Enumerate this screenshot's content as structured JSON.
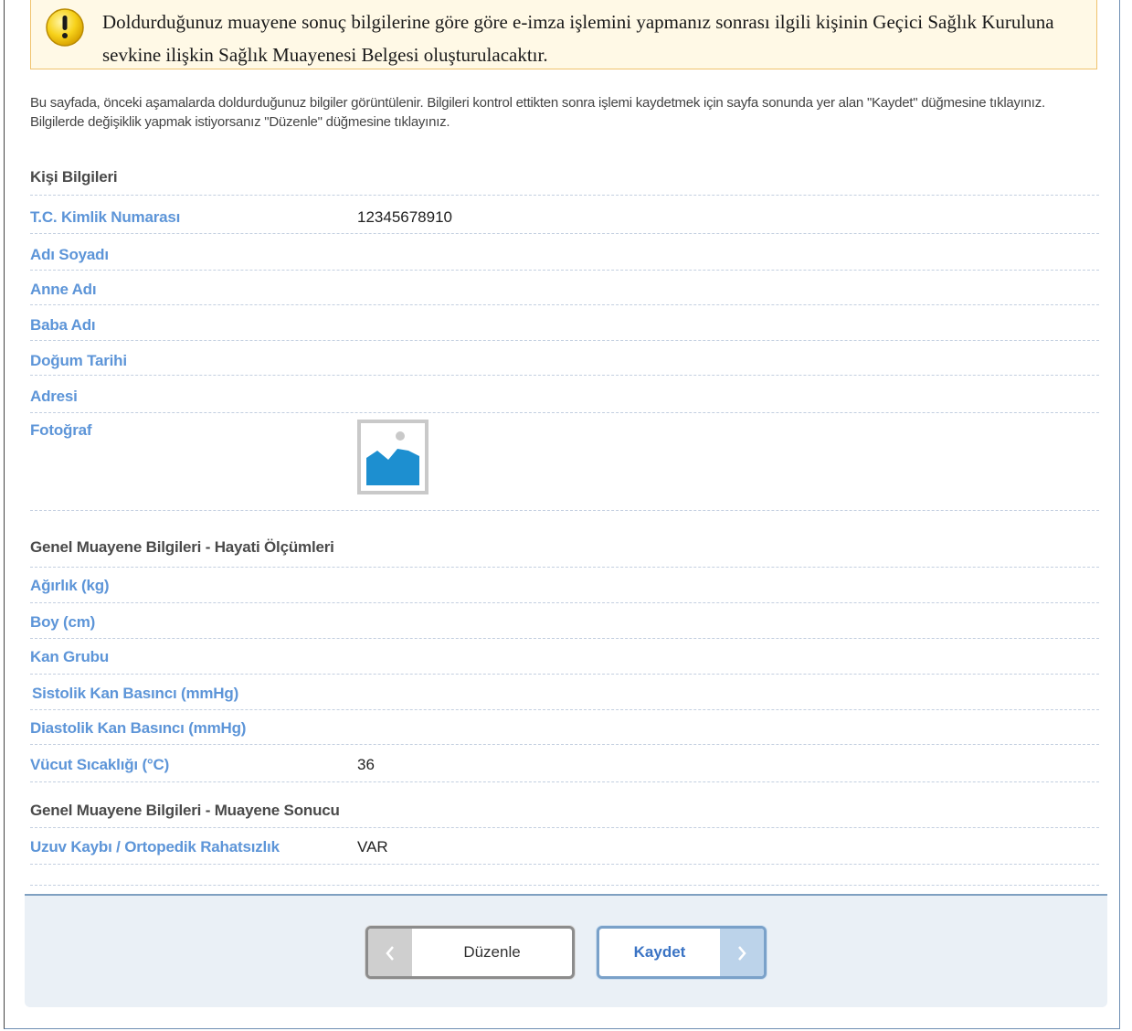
{
  "warning": {
    "icon": "warning-icon",
    "text": "Doldurduğunuz muayene sonuç bilgilerine göre göre e-imza işlemini yapmanız sonrası ilgili kişinin Geçici Sağlık Kuruluna sevkine ilişkin Sağlık Muayenesi Belgesi oluşturulacaktır."
  },
  "intro": "Bu sayfada, önceki aşamalarda doldurduğunuz bilgiler görüntülenir. Bilgileri kontrol ettikten sonra işlemi kaydetmek için sayfa sonunda yer alan \"Kaydet\" düğmesine tıklayınız. Bilgilerde değişiklik yapmak istiyorsanız \"Düzenle\" düğmesine tıklayınız.",
  "person": {
    "title": "Kişi Bilgileri",
    "tc_label": "T.C. Kimlik Numarası",
    "tc_value": "12345678910",
    "name_label": "Adı Soyadı",
    "name_value": "",
    "mother_label": "Anne Adı",
    "mother_value": "",
    "father_label": "Baba Adı",
    "father_value": "",
    "birth_label": "Doğum Tarihi",
    "birth_value": "",
    "address_label": "Adresi",
    "address_value": "",
    "photo_label": "Fotoğraf",
    "photo_icon": "image-placeholder-icon"
  },
  "vitals": {
    "title": "Genel Muayene Bilgileri - Hayati Ölçümleri",
    "weight_label": "Ağırlık (kg)",
    "weight_value": "",
    "height_label": "Boy (cm)",
    "height_value": "",
    "blood_label": "Kan Grubu",
    "blood_value": "",
    "systolic_label": "Sistolik Kan Basıncı (mmHg)",
    "systolic_value": "",
    "diastolic_label": "Diastolik Kan Basıncı (mmHg)",
    "diastolic_value": "",
    "temp_label": "Vücut Sıcaklığı (°C)",
    "temp_value": "36"
  },
  "result": {
    "title": "Genel Muayene Bilgileri - Muayene Sonucu",
    "limb_label": "Uzuv Kaybı / Ortopedik Rahatsızlık",
    "limb_value": "VAR"
  },
  "buttons": {
    "edit_label": "Düzenle",
    "save_label": "Kaydet"
  },
  "colors": {
    "label_blue": "#5d95d8",
    "warning_border": "#f0c36d",
    "save_text": "#3a73c4"
  }
}
